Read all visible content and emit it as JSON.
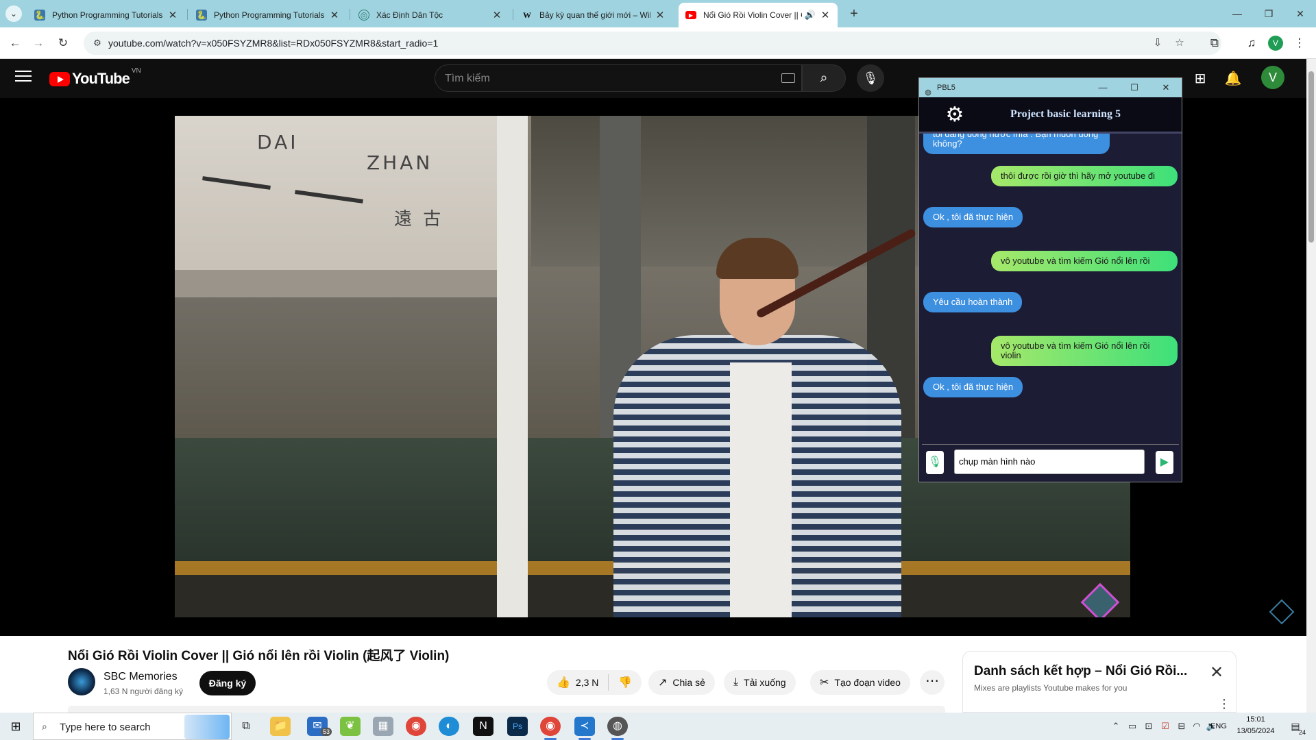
{
  "browser": {
    "tabs": [
      {
        "title": "Python Programming Tutorials",
        "favicon": "python-icon"
      },
      {
        "title": "Python Programming Tutorials",
        "favicon": "python-icon"
      },
      {
        "title": "Xác Định Dân Tộc",
        "favicon": "globe-icon"
      },
      {
        "title": "Bảy kỳ quan thế giới mới – Wiki",
        "favicon": "wikipedia-icon"
      },
      {
        "title": "Nổi Gió Rồi Violin Cover || G",
        "favicon": "youtube-icon",
        "active": true,
        "audio": true
      }
    ],
    "url": "youtube.com/watch?v=x050FSYZMR8&list=RDx050FSYZMR8&start_radio=1",
    "profile_initial": "V"
  },
  "youtube": {
    "logo_text": "YouTube",
    "country_code": "VN",
    "search_placeholder": "Tìm kiếm",
    "avatar_initial": "V",
    "video": {
      "title": "Nổi Gió Rồi Violin Cover || Gió nổi lên rồi Violin (起风了 Violin)",
      "sign_words": [
        "DAI",
        "ZHAN"
      ],
      "sign_chinese": "遠 古"
    },
    "channel": {
      "name": "SBC Memories",
      "subscribers": "1,63 N người đăng ký",
      "subscribe_label": "Đăng ký"
    },
    "actions": {
      "likes": "2,3 N",
      "share": "Chia sẻ",
      "download": "Tải xuống",
      "clip": "Tạo đoạn video"
    },
    "mix": {
      "title": "Danh sách kết hợp – Nổi Gió Rồi...",
      "subtitle": "Mixes are playlists Youtube makes for you"
    }
  },
  "pbl5": {
    "window_title": "PBL5",
    "app_title": "Project basic learning 5",
    "messages": [
      {
        "from": "bot",
        "text": "tôi đang uống nước mía . Bạn muốn uống không?"
      },
      {
        "from": "user",
        "text": "thôi được rồi giờ thì hãy mở youtube đi"
      },
      {
        "from": "bot",
        "text": "Ok , tôi đã thực hiện"
      },
      {
        "from": "user",
        "text": "vô youtube và tìm kiếm Gió nổi lên rồi"
      },
      {
        "from": "bot",
        "text": "Yêu cầu hoàn thành"
      },
      {
        "from": "user",
        "text": "vô youtube và tìm kiếm Gió nổi lên rồi violin"
      },
      {
        "from": "bot",
        "text": "Ok , tôi đã thực hiện"
      }
    ],
    "input_value": "chụp màn hình nào"
  },
  "taskbar": {
    "search_placeholder": "Type here to search",
    "mail_badge": "53",
    "language": "ENG",
    "time": "15:01",
    "date": "13/05/2024",
    "notification_count": "24"
  },
  "colors": {
    "tabstrip": "#9fd3df",
    "youtube_red": "#ff0000",
    "bot_bubble": "#3d8fe0",
    "user_bubble_start": "#a6e86a",
    "user_bubble_end": "#3ee07a",
    "pbl_bg": "#1c1c35"
  }
}
